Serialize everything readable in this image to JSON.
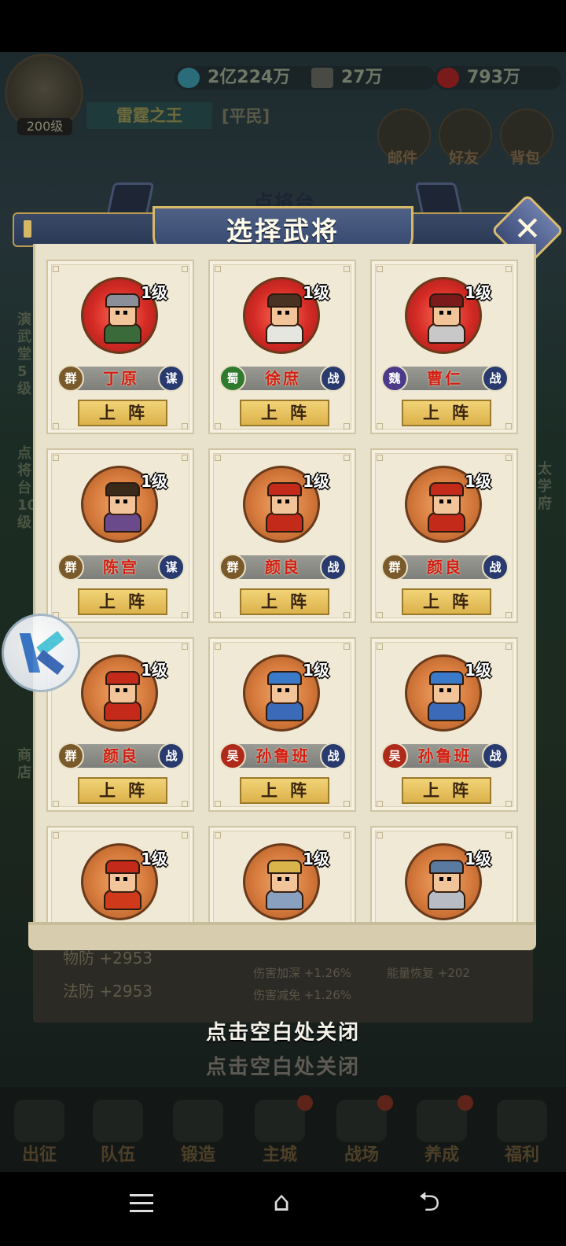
{
  "background": {
    "player_level": "200级",
    "resources": [
      {
        "icon": "exp-icon",
        "value": "2亿224万",
        "color": "#2b6c7a"
      },
      {
        "icon": "scroll-icon",
        "value": "27万",
        "color": "#4a4a44"
      },
      {
        "icon": "heart-icon",
        "value": "793万",
        "color": "#7a1a1a"
      }
    ],
    "player_name": "雷霆之王",
    "player_rank": "[平民]",
    "top_buttons": [
      "邮件",
      "好友",
      "背包"
    ],
    "panel_title": "点将台",
    "left_side_texts": [
      "演武堂5级",
      "点将台10级",
      "商店"
    ],
    "right_side_texts": [
      "太学府"
    ],
    "stats": [
      {
        "label": "物防",
        "value": "+2953"
      },
      {
        "label": "法防",
        "value": "+2953"
      }
    ],
    "stats_small": [
      "伤害加深 +1.26%",
      "伤害减免 +1.26%",
      "能量恢复 +202"
    ],
    "close_hint_shadow": "点击空白处关闭",
    "bottom_nav": [
      "出征",
      "队伍",
      "锻造",
      "主城",
      "战场",
      "养成",
      "福利"
    ]
  },
  "dialog": {
    "title": "选择武将",
    "close_symbol": "✕",
    "deploy_label": "上阵",
    "generals": [
      {
        "name": "丁原",
        "level": "1级",
        "faction": "群",
        "role": "谋",
        "bg": "red",
        "faction_color": "#7a5a2a",
        "hat": "#8a8f99",
        "robe": "#3a6a3a"
      },
      {
        "name": "徐庶",
        "level": "1级",
        "faction": "蜀",
        "role": "战",
        "bg": "red",
        "faction_color": "#2f7a2f",
        "hat": "#4a3222",
        "robe": "#e6e6e0"
      },
      {
        "name": "曹仁",
        "level": "1级",
        "faction": "魏",
        "role": "战",
        "bg": "red",
        "faction_color": "#4b3a8a",
        "hat": "#7a1a1a",
        "robe": "#c8c8c8"
      },
      {
        "name": "陈宫",
        "level": "1级",
        "faction": "群",
        "role": "谋",
        "bg": "orange",
        "faction_color": "#7a5a2a",
        "hat": "#3a2a1a",
        "robe": "#6a4a8a"
      },
      {
        "name": "颜良",
        "level": "1级",
        "faction": "群",
        "role": "战",
        "bg": "orange",
        "faction_color": "#7a5a2a",
        "hat": "#c42a1a",
        "robe": "#c42a1a"
      },
      {
        "name": "颜良",
        "level": "1级",
        "faction": "群",
        "role": "战",
        "bg": "orange",
        "faction_color": "#7a5a2a",
        "hat": "#c42a1a",
        "robe": "#c42a1a"
      },
      {
        "name": "颜良",
        "level": "1级",
        "faction": "群",
        "role": "战",
        "bg": "orange",
        "faction_color": "#7a5a2a",
        "hat": "#c42a1a",
        "robe": "#c42a1a"
      },
      {
        "name": "孙鲁班",
        "level": "1级",
        "faction": "吴",
        "role": "战",
        "bg": "orange",
        "faction_color": "#b02a1a",
        "hat": "#3a7ac8",
        "robe": "#3a6ab8"
      },
      {
        "name": "孙鲁班",
        "level": "1级",
        "faction": "吴",
        "role": "战",
        "bg": "orange",
        "faction_color": "#b02a1a",
        "hat": "#3a7ac8",
        "robe": "#3a6ab8"
      },
      {
        "name": "",
        "level": "1级",
        "faction": "",
        "role": "",
        "bg": "orange",
        "faction_color": "#7a5a2a",
        "hat": "#c42a1a",
        "robe": "#d03a1a"
      },
      {
        "name": "",
        "level": "1级",
        "faction": "",
        "role": "",
        "bg": "orange",
        "faction_color": "#7a5a2a",
        "hat": "#d8b44a",
        "robe": "#8aa0c0"
      },
      {
        "name": "",
        "level": "1级",
        "faction": "",
        "role": "",
        "bg": "orange",
        "faction_color": "#7a5a2a",
        "hat": "#5a7aa0",
        "robe": "#b8bcc4"
      }
    ]
  },
  "close_hint": "点击空白处关闭",
  "android_nav": {
    "home_symbol": "⌂",
    "back_symbol": "⮌"
  }
}
